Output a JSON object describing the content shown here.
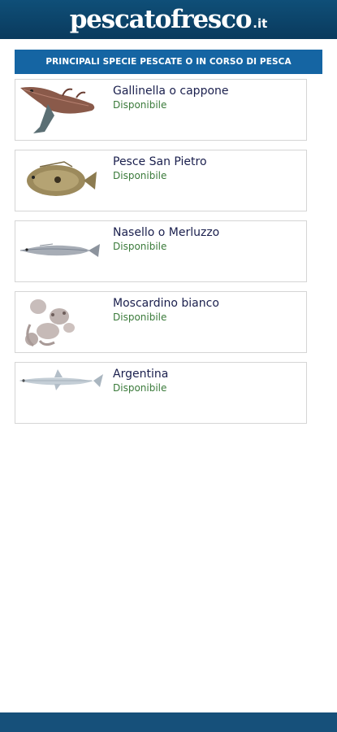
{
  "header": {
    "logo_text": "pescatofresco",
    "logo_suffix": ".it"
  },
  "section": {
    "title": "PRINCIPALI SPECIE PESCATE O IN CORSO DI PESCA"
  },
  "items": [
    {
      "name": "Gallinella o cappone",
      "status": "Disponibile",
      "image_icon": "gurnard-fish-image"
    },
    {
      "name": "Pesce San Pietro",
      "status": "Disponibile",
      "image_icon": "john-dory-fish-image"
    },
    {
      "name": "Nasello o Merluzzo",
      "status": "Disponibile",
      "image_icon": "hake-fish-image"
    },
    {
      "name": "Moscardino bianco",
      "status": "Disponibile",
      "image_icon": "octopus-image"
    },
    {
      "name": "Argentina",
      "status": "Disponibile",
      "image_icon": "argentine-fish-image"
    }
  ],
  "colors": {
    "header_bg": "#0a3a5d",
    "banner_bg": "#1565a3",
    "name_text": "#1a1f4d",
    "status_text": "#3a7a3a"
  }
}
